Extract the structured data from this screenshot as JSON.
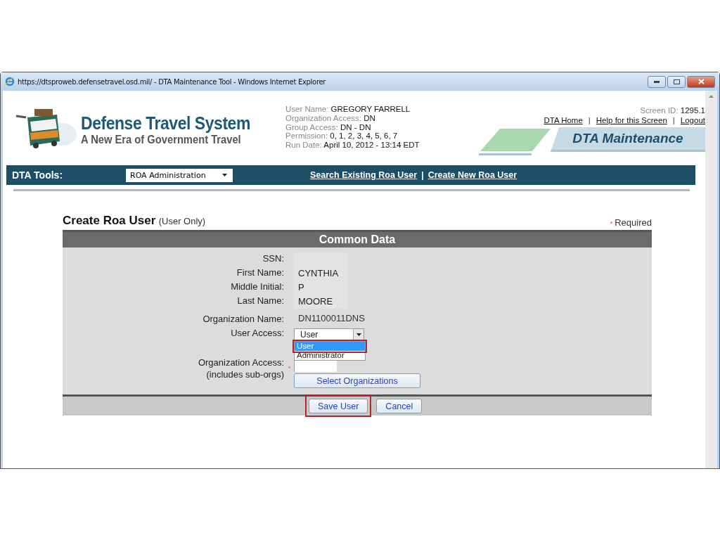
{
  "window": {
    "title": "https://dtsproweb.defensetravel.osd.mil/ - DTA Maintenance Tool - Windows Internet Explorer"
  },
  "header": {
    "logo_title": "Defense Travel System",
    "logo_subtitle": "A New Era of Government Travel",
    "user_info": [
      {
        "label": "User Name:",
        "value": "GREGORY FARRELL"
      },
      {
        "label": "Organization Access:",
        "value": "DN"
      },
      {
        "label": "Group Access:",
        "value": "DN - DN"
      },
      {
        "label": "Permission:",
        "value": "0, 1, 2, 3, 4, 5, 6, 7"
      },
      {
        "label": "Run Date:",
        "value": "April 10, 2012 - 13:14 EDT"
      }
    ],
    "screen_id": {
      "label": "Screen ID:",
      "value": "1295.1"
    },
    "links": [
      "DTA Home",
      "Help for this Screen",
      "Logout"
    ],
    "separators": [
      "|",
      "|"
    ],
    "banner": "DTA Maintenance"
  },
  "toolbar": {
    "label": "DTA Tools:",
    "select": "ROA Administration",
    "links": [
      "Search Existing Roa User",
      "Create New Roa User"
    ],
    "separator": "|"
  },
  "form": {
    "title": "Create Roa User",
    "subtitle": "(User Only)",
    "required_label": "Required",
    "section": "Common Data",
    "fields": [
      {
        "kind": "text",
        "label": "SSN:"
      },
      {
        "kind": "text",
        "label": "First Name:",
        "value": "CYNTHIA"
      },
      {
        "kind": "text",
        "label": "Middle Initial:",
        "value": "P"
      },
      {
        "kind": "text",
        "label": "Last Name:",
        "value": "MOORE"
      },
      {
        "kind": "plain",
        "label": "Organization Name:",
        "value": "DN1100011DNS"
      },
      {
        "kind": "select",
        "label": "User Access:",
        "value": "User",
        "options": [
          {
            "label": "User",
            "selected": true,
            "highlighted": true
          },
          {
            "label": "Administrator",
            "selected": false,
            "highlighted": false
          }
        ]
      },
      {
        "kind": "list",
        "label": "Organization Access:",
        "label_2": "(includes sub-orgs)",
        "required": true,
        "button": "Select Organizations"
      }
    ],
    "buttons": [
      {
        "label": "Save User",
        "highlighted": true
      },
      {
        "label": "Cancel",
        "highlighted": false
      }
    ]
  }
}
